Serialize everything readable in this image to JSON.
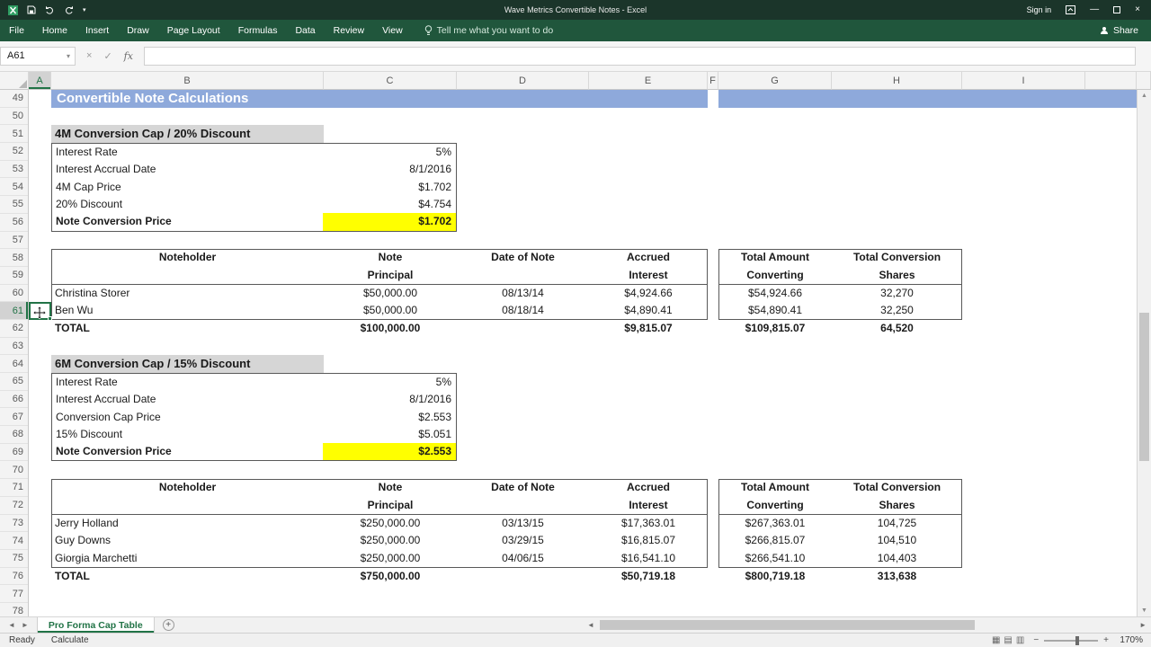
{
  "window": {
    "title": "Wave Metrics Convertible Notes - Excel",
    "sign_in": "Sign in"
  },
  "ribbon": {
    "tabs": [
      "File",
      "Home",
      "Insert",
      "Draw",
      "Page Layout",
      "Formulas",
      "Data",
      "Review",
      "View"
    ],
    "tell_me": "Tell me what you want to do",
    "share": "Share"
  },
  "formula_bar": {
    "name_box": "A61",
    "fx_label": "fx",
    "formula": ""
  },
  "grid": {
    "column_headers": [
      "A",
      "B",
      "C",
      "D",
      "E",
      "F",
      "G",
      "H",
      "I",
      ""
    ],
    "row_headers": [
      "49",
      "50",
      "51",
      "52",
      "53",
      "54",
      "55",
      "56",
      "57",
      "58",
      "59",
      "60",
      "61",
      "62",
      "63",
      "64",
      "65",
      "66",
      "67",
      "68",
      "69",
      "70",
      "71",
      "72",
      "73",
      "74",
      "75",
      "76",
      "77",
      "78"
    ],
    "active_cell": "A61"
  },
  "banner": {
    "text": "Convertible Note Calculations"
  },
  "sections": [
    {
      "title": "4M Conversion Cap / 20% Discount",
      "details": [
        [
          "Interest Rate",
          "5%"
        ],
        [
          "Interest Accrual Date",
          "8/1/2016"
        ],
        [
          "4M Cap Price",
          "$1.702"
        ],
        [
          "20% Discount",
          "$4.754"
        ],
        [
          "Note Conversion Price",
          "$1.702"
        ]
      ],
      "table": {
        "headers": [
          [
            "Noteholder"
          ],
          [
            "Note",
            "Principal"
          ],
          [
            "Date of Note"
          ],
          [
            "Accrued",
            "Interest"
          ],
          [
            "Total Amount",
            "Converting"
          ],
          [
            "Total Conversion",
            "Shares"
          ]
        ],
        "rows": [
          [
            "Christina Storer",
            "$50,000.00",
            "08/13/14",
            "$4,924.66",
            "$54,924.66",
            "32,270"
          ],
          [
            "Ben Wu",
            "$50,000.00",
            "08/18/14",
            "$4,890.41",
            "$54,890.41",
            "32,250"
          ]
        ],
        "total": [
          "TOTAL",
          "$100,000.00",
          "$9,815.07",
          "$109,815.07",
          "64,520"
        ]
      }
    },
    {
      "title": "6M Conversion Cap / 15% Discount",
      "details": [
        [
          "Interest Rate",
          "5%"
        ],
        [
          "Interest Accrual Date",
          "8/1/2016"
        ],
        [
          "Conversion Cap Price",
          "$2.553"
        ],
        [
          "15% Discount",
          "$5.051"
        ],
        [
          "Note Conversion Price",
          "$2.553"
        ]
      ],
      "table": {
        "headers": [
          [
            "Noteholder"
          ],
          [
            "Note",
            "Principal"
          ],
          [
            "Date of Note"
          ],
          [
            "Accrued",
            "Interest"
          ],
          [
            "Total Amount",
            "Converting"
          ],
          [
            "Total Conversion",
            "Shares"
          ]
        ],
        "rows": [
          [
            "Jerry Holland",
            "$250,000.00",
            "03/13/15",
            "$17,363.01",
            "$267,363.01",
            "104,725"
          ],
          [
            "Guy Downs",
            "$250,000.00",
            "03/29/15",
            "$16,815.07",
            "$266,815.07",
            "104,510"
          ],
          [
            "Giorgia Marchetti",
            "$250,000.00",
            "04/06/15",
            "$16,541.10",
            "$266,541.10",
            "104,403"
          ]
        ],
        "total": [
          "TOTAL",
          "$750,000.00",
          "$50,719.18",
          "$800,719.18",
          "313,638"
        ]
      }
    }
  ],
  "sheet_tabs": {
    "active": "Pro Forma Cap Table",
    "add_label": "+"
  },
  "status": {
    "mode": "Ready",
    "calculate": "Calculate",
    "zoom": "170%"
  }
}
